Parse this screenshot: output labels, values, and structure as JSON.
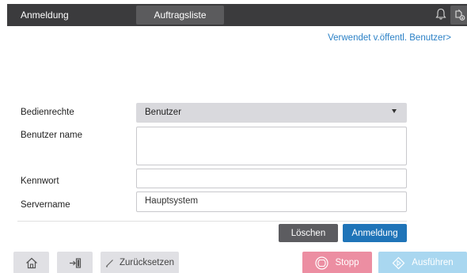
{
  "header": {
    "title": "Anmeldung",
    "jobs_tab": "Auftragsliste",
    "icons": [
      "bell-icon",
      "usb-icon",
      "info-icon"
    ]
  },
  "public_user_link": "Verwendet v.öffentl. Benutzer>",
  "form": {
    "rights_label": "Bedienrechte",
    "rights_value": "Benutzer",
    "username_label": "Benutzer name",
    "username_value": "",
    "password_label": "Kennwort",
    "password_value": "",
    "server_label": "Servername",
    "server_value": "Hauptsystem"
  },
  "actions": {
    "delete": "Löschen",
    "login": "Anmeldung"
  },
  "bottom": {
    "reset": "Zurücksetzen",
    "stop": "Stopp",
    "start": "Ausführen"
  },
  "colors": {
    "topbar": "#3b3b3d",
    "link": "#2a80c6",
    "login_button": "#1f74b8",
    "delete_button": "#5c5c60",
    "stop_button": "#ec8ea2",
    "start_button": "#a9d7f0"
  }
}
